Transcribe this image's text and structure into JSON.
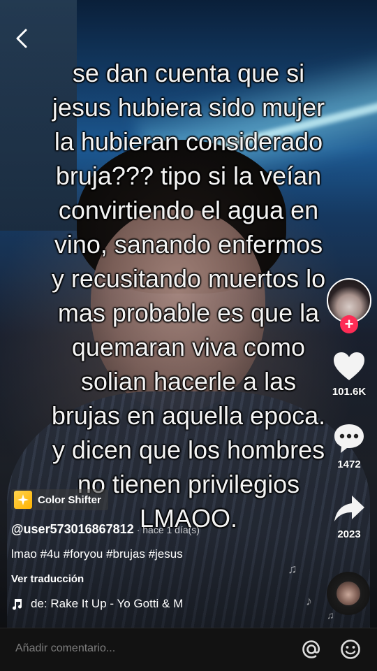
{
  "overlay_text": "se dan cuenta que si\njesus hubiera sido mujer\nla hubieran considerado\nbruja??? tipo si la veían\nconvirtiendo el agua en\nvino, sanando enfermos\ny recusitando muertos lo\nmas probable es que la\nquemaran viva como\nsolian hacerle a las\nbrujas en aquella epoca.\ny dicen que los hombres\nno tienen privilegios\nLMAOO.",
  "rail": {
    "likes": "101.6K",
    "comments": "1472",
    "shares": "2023",
    "follow_symbol": "+"
  },
  "effect": {
    "label": "Color Shifter"
  },
  "post": {
    "username": "@user573016867812",
    "timestamp": "· hace 1 día(s)",
    "caption": "lmao #4u #foryou #brujas #jesus",
    "translate_label": "Ver traducción",
    "sound": "de: Rake It Up - Yo Gotti & M"
  },
  "comment_bar": {
    "placeholder": "Añadir comentario..."
  },
  "icons": {
    "back": "chevron-left-icon",
    "like": "heart-icon",
    "comment": "speech-bubble-icon",
    "share": "share-arrow-icon",
    "music": "music-note-icon",
    "mention": "at-sign-icon",
    "emoji": "smiley-icon"
  },
  "colors": {
    "follow_accent": "#fe2c55",
    "effect_accent": "#ffc21a"
  }
}
